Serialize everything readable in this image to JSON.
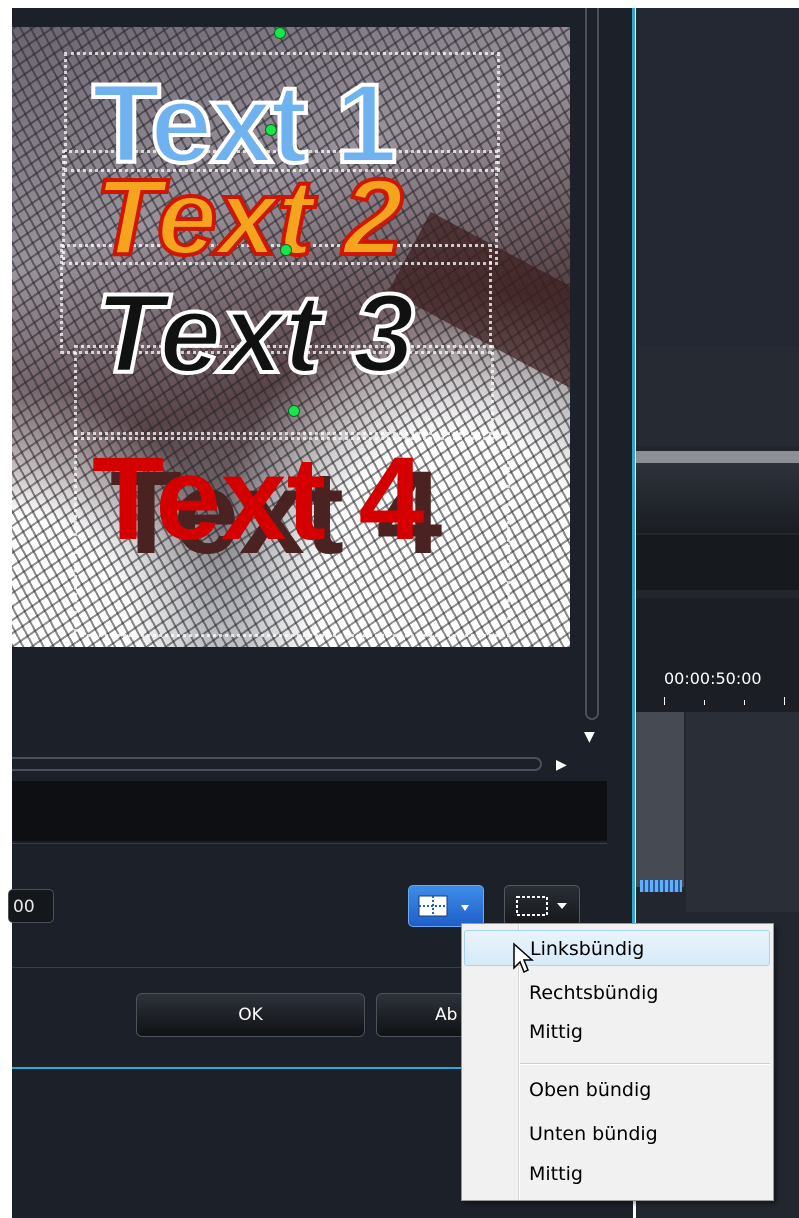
{
  "preview": {
    "texts": [
      "Text 1",
      "Text 2",
      "Text 3",
      "Text 4"
    ]
  },
  "controls": {
    "value_field": "00",
    "align_button_icon": "align-grid-icon",
    "frame_button_icon": "frame-icon"
  },
  "buttons": {
    "ok": "OK",
    "cancel": "Ab"
  },
  "timeline": {
    "timecode": "00:00:50:00"
  },
  "align_menu": {
    "items": [
      "Linksbündig",
      "Rechtsbündig",
      "Mittig",
      "Oben bündig",
      "Unten bündig",
      "Mittig"
    ],
    "highlighted_index": 0
  },
  "colors": {
    "accent": "#2fa6d2",
    "handle": "#19e64a",
    "menu_highlight": "#d6eaf9"
  }
}
